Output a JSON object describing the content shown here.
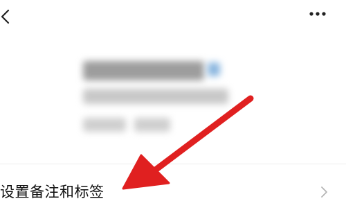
{
  "header": {
    "back_icon": "chevron-left-icon",
    "more_icon": "more-horizontal-icon"
  },
  "profile": {
    "blurred": true,
    "badge_color": "#8ab6df"
  },
  "settings": {
    "items": [
      {
        "label": "设置备注和标签",
        "icon": "chevron-right-icon"
      }
    ]
  },
  "annotation": {
    "arrow_icon": "red-arrow-icon",
    "color": "#e02020"
  }
}
